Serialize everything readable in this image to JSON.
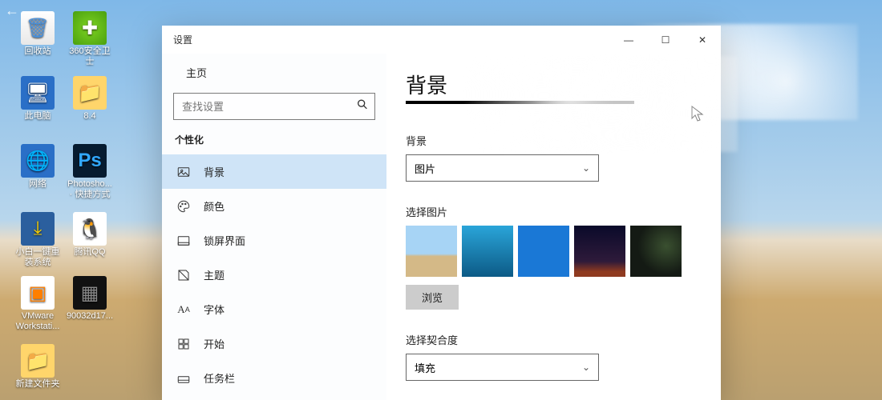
{
  "overlay": {
    "back": "←"
  },
  "desktop": {
    "icons": [
      {
        "label": "回收站",
        "glyph": "🗑"
      },
      {
        "label": "360安全卫士",
        "glyph": "✚"
      },
      {
        "label": "此电脑",
        "glyph": "🖥"
      },
      {
        "label": "8.4",
        "glyph": "📁"
      },
      {
        "label": "网络",
        "glyph": "🌐"
      },
      {
        "label": "Photosho... · 快捷方式",
        "glyph": "Ps"
      },
      {
        "label": "小白一键重装系统",
        "glyph": "⤓"
      },
      {
        "label": "腾讯QQ",
        "glyph": "🐧"
      },
      {
        "label": "VMware Workstati...",
        "glyph": "▣"
      },
      {
        "label": "90032d17...",
        "glyph": "▦"
      },
      {
        "label": "新建文件夹",
        "glyph": "📁"
      }
    ]
  },
  "window": {
    "title": "设置",
    "controls": {
      "min": "—",
      "max": "☐",
      "close": "✕"
    },
    "home_label": "主页",
    "search_placeholder": "查找设置",
    "section": "个性化",
    "nav": [
      {
        "label": "背景"
      },
      {
        "label": "颜色"
      },
      {
        "label": "锁屏界面"
      },
      {
        "label": "主题"
      },
      {
        "label": "字体"
      },
      {
        "label": "开始"
      },
      {
        "label": "任务栏"
      }
    ],
    "main": {
      "heading": "背景",
      "bg_label": "背景",
      "bg_value": "图片",
      "choose_label": "选择图片",
      "browse": "浏览",
      "fit_label": "选择契合度",
      "fit_value": "填充"
    }
  }
}
